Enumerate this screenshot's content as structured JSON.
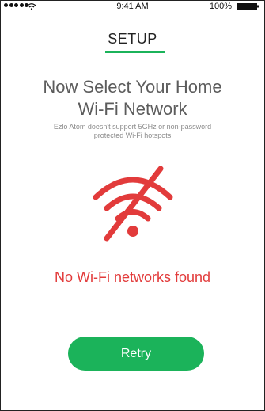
{
  "status_bar": {
    "time": "9:41 AM",
    "battery": "100%"
  },
  "header": {
    "title": "SETUP"
  },
  "main": {
    "heading_line1": "Now Select Your Home",
    "heading_line2": "Wi-Fi Network",
    "subtext_line1": "Ezlo Atom doesn't support 5GHz or non-password",
    "subtext_line2": "protected Wi-Fi hotspots",
    "empty_message": "No Wi-Fi networks found",
    "retry_label": "Retry"
  },
  "icons": {
    "signal": "cellular-signal-icon",
    "wifi_status": "wifi-icon",
    "battery": "battery-icon",
    "wifi_off": "wifi-off-icon"
  },
  "colors": {
    "accent": "#1bb35a",
    "error": "#e23b3b",
    "text": "#5c5c5c",
    "subtext": "#8a8a8a"
  }
}
